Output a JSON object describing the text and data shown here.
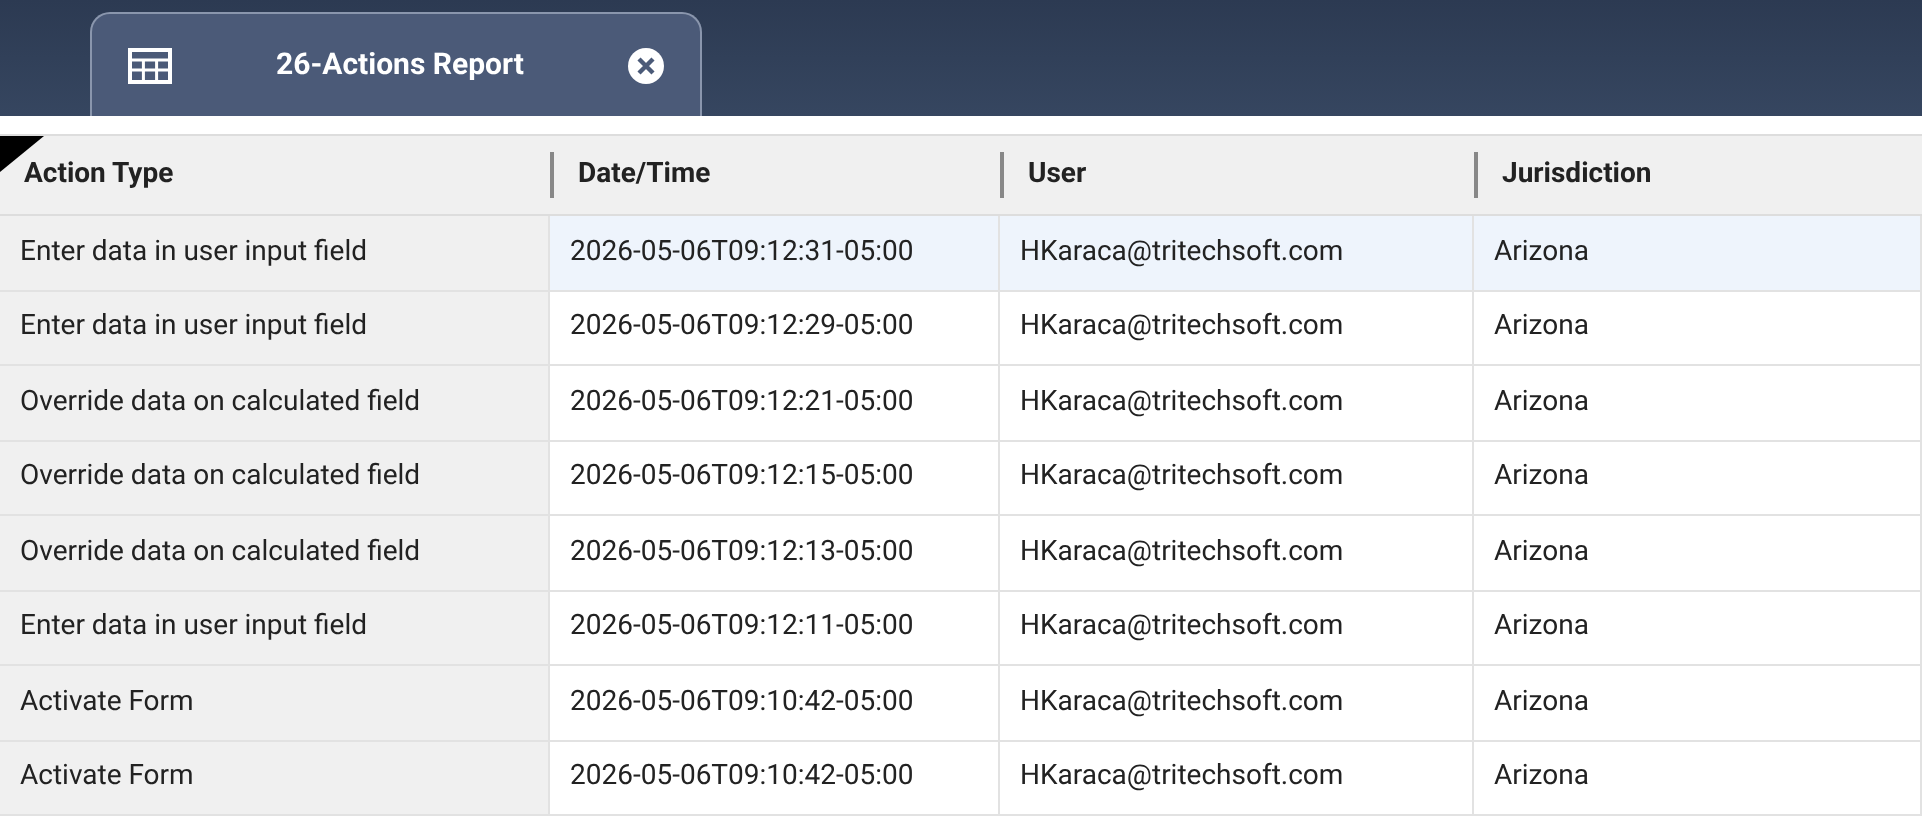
{
  "tab": {
    "title": "26-Actions Report",
    "selected": true
  },
  "table": {
    "columns": [
      "Action Type",
      "Date/Time",
      "User",
      "Jurisdiction"
    ],
    "rows": [
      {
        "selected": true,
        "cells": [
          "Enter data in user input field",
          "2026-05-06T09:12:31-05:00",
          "HKaraca@tritechsoft.com",
          "Arizona"
        ]
      },
      {
        "selected": false,
        "cells": [
          "Enter data in user input field",
          "2026-05-06T09:12:29-05:00",
          "HKaraca@tritechsoft.com",
          "Arizona"
        ]
      },
      {
        "selected": false,
        "cells": [
          "Override data on calculated field",
          "2026-05-06T09:12:21-05:00",
          "HKaraca@tritechsoft.com",
          "Arizona"
        ]
      },
      {
        "selected": false,
        "cells": [
          "Override data on calculated field",
          "2026-05-06T09:12:15-05:00",
          "HKaraca@tritechsoft.com",
          "Arizona"
        ]
      },
      {
        "selected": false,
        "cells": [
          "Override data on calculated field",
          "2026-05-06T09:12:13-05:00",
          "HKaraca@tritechsoft.com",
          "Arizona"
        ]
      },
      {
        "selected": false,
        "cells": [
          "Enter data in user input field",
          "2026-05-06T09:12:11-05:00",
          "HKaraca@tritechsoft.com",
          "Arizona"
        ]
      },
      {
        "selected": false,
        "cells": [
          "Activate Form",
          "2026-05-06T09:10:42-05:00",
          "HKaraca@tritechsoft.com",
          "Arizona"
        ]
      },
      {
        "selected": false,
        "cells": [
          "Activate Form",
          "2026-05-06T09:10:42-05:00",
          "HKaraca@tritechsoft.com",
          "Arizona"
        ]
      }
    ]
  }
}
